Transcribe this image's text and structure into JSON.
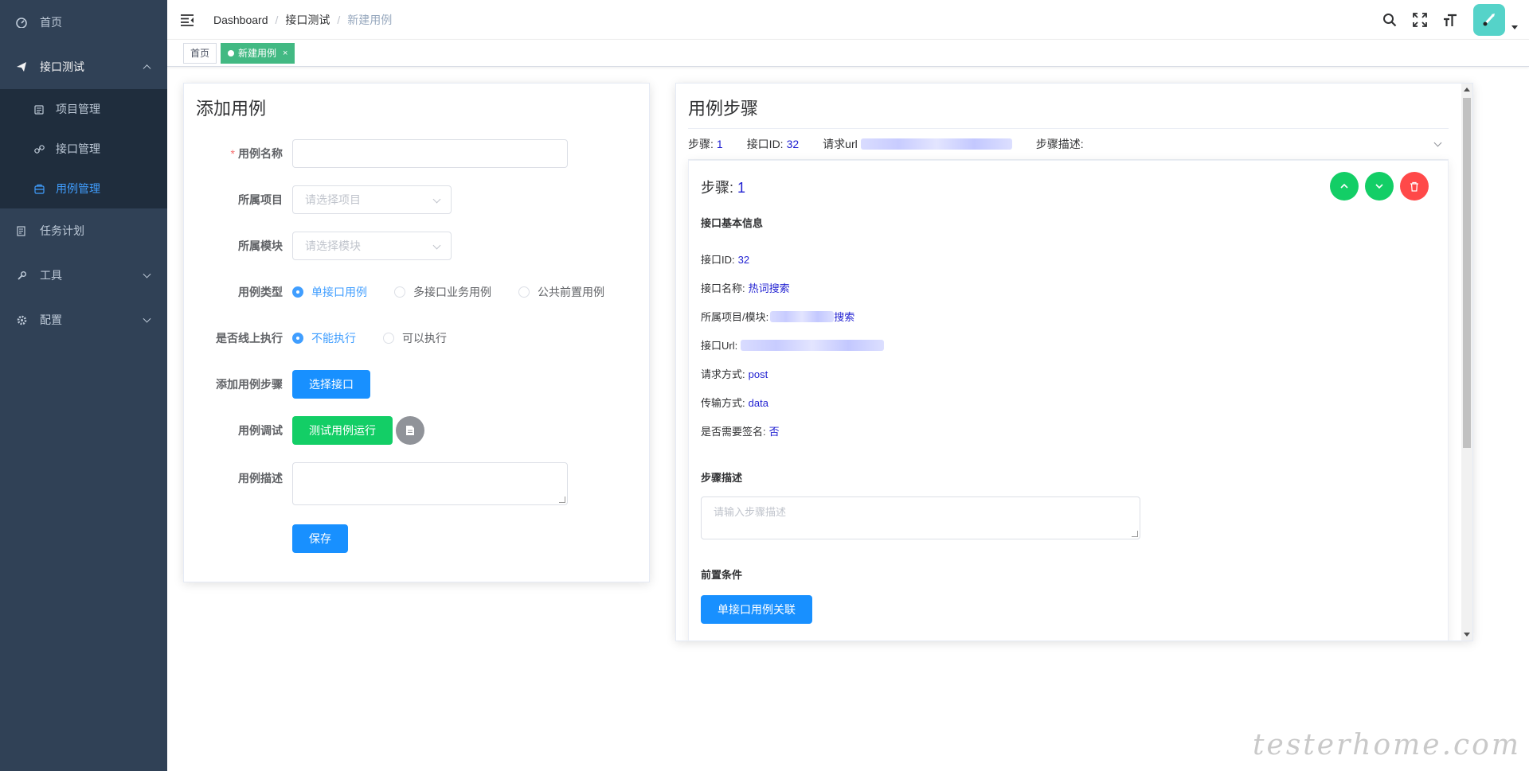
{
  "sidebar": {
    "items": [
      {
        "label": "首页",
        "icon": "dashboard-icon"
      },
      {
        "label": "接口测试",
        "icon": "paper-plane-icon",
        "expanded": true,
        "children": [
          {
            "label": "项目管理",
            "icon": "clipboard-icon"
          },
          {
            "label": "接口管理",
            "icon": "link-icon"
          },
          {
            "label": "用例管理",
            "icon": "case-icon",
            "active": true
          }
        ]
      },
      {
        "label": "任务计划",
        "icon": "task-icon"
      },
      {
        "label": "工具",
        "icon": "wrench-icon"
      },
      {
        "label": "配置",
        "icon": "gear-icon"
      }
    ]
  },
  "header": {
    "breadcrumb": [
      "Dashboard",
      "接口测试",
      "新建用例"
    ]
  },
  "tags": [
    {
      "label": "首页",
      "active": false
    },
    {
      "label": "新建用例",
      "active": true,
      "close": "×"
    }
  ],
  "left_card": {
    "title": "添加用例",
    "fields": {
      "name_label": "用例名称",
      "project_label": "所属项目",
      "project_placeholder": "请选择项目",
      "module_label": "所属模块",
      "module_placeholder": "请选择模块",
      "type_label": "用例类型",
      "type_options": [
        "单接口用例",
        "多接口业务用例",
        "公共前置用例"
      ],
      "online_label": "是否线上执行",
      "online_options": [
        "不能执行",
        "可以执行"
      ],
      "add_step_label": "添加用例步骤",
      "select_api_button": "选择接口",
      "debug_label": "用例调试",
      "run_test_button": "测试用例运行",
      "desc_label": "用例描述",
      "save_button": "保存"
    }
  },
  "right_card": {
    "title": "用例步骤",
    "summary": {
      "step_key": "步骤:",
      "step_value": "1",
      "api_id_key": "接口ID:",
      "api_id_value": "32",
      "url_key": "请求url",
      "desc_key": "步骤描述:"
    },
    "step": {
      "title_key": "步骤:",
      "title_value": "1",
      "basic_info": "接口基本信息",
      "api_id_key": "接口ID:",
      "api_id_value": "32",
      "api_name_key": "接口名称:",
      "api_name_value": "热词搜索",
      "project_module_key": "所属项目/模块:",
      "project_module_value": "搜索",
      "url_key": "接口Url:",
      "method_key": "请求方式:",
      "method_value": "post",
      "transfer_key": "传输方式:",
      "transfer_value": "data",
      "sign_key": "是否需要签名:",
      "sign_value": "否",
      "step_desc_label": "步骤描述",
      "step_desc_placeholder": "请输入步骤描述",
      "precondition_label": "前置条件",
      "link_button": "单接口用例关联"
    }
  },
  "watermark": "testerhome.com",
  "colors": {
    "sidebar_bg": "#304156",
    "submenu_bg": "#1f2d3d",
    "primary": "#1890ff",
    "success": "#13ce66",
    "danger": "#ff4949",
    "tag_active": "#42b983"
  }
}
